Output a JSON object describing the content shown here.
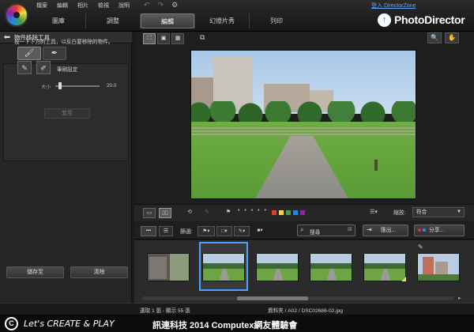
{
  "menubar": [
    "檔案",
    "編輯",
    "相片",
    "檢視",
    "說明"
  ],
  "login_link": "登入 DirectorZone",
  "brand": {
    "name": "PhotoDirector",
    "arrow": "↑"
  },
  "main_tabs": [
    {
      "label": "圖庫",
      "active": false
    },
    {
      "label": "調整",
      "active": false
    },
    {
      "label": "編輯",
      "active": true
    },
    {
      "label": "幻燈片秀",
      "active": false
    },
    {
      "label": "列印",
      "active": false
    }
  ],
  "left_panel": {
    "title": "物件移除工具",
    "instructions": "按一下下方的工具，以反白要移除的物件。",
    "brush_settings_label": "筆刷設定",
    "size_label": "大小",
    "size_value": "20.0",
    "size_fraction": 0.1,
    "apply_label": "套用",
    "save_label": "儲存至",
    "reset_label": "清除"
  },
  "viewer_toolbar": {
    "rating_dots": "• • • • •",
    "color_labels": [
      "#e53935",
      "#fdd835",
      "#43a047",
      "#1e88e5",
      "#8e24aa"
    ],
    "zoom_label": "縮放:",
    "zoom_value": "符合"
  },
  "filter_bar": {
    "filter_label": "篩選:",
    "search_text": "搜尋",
    "export_label": "匯出...",
    "share_label": "分享..."
  },
  "status": {
    "left": "選取 1 張 - 顯示 55 張",
    "path": "資料夾 / A02 / DSC02686-02.jpg"
  },
  "banner": {
    "slogan": "Let's CREATE & PLAY",
    "title": "訊連科技 2014 Computex網友體驗會"
  },
  "accent_color": "#4aa3ff"
}
